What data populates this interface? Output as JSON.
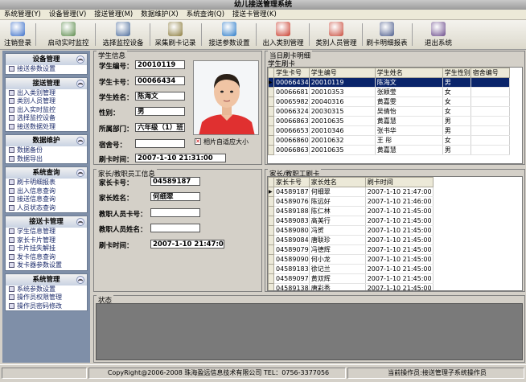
{
  "window": {
    "title": "幼儿接送管理系统"
  },
  "menu": [
    "系统管理(Y)",
    "设备管理(V)",
    "接送管理(M)",
    "数据维护(X)",
    "系统查询(Q)",
    "接送卡管理(K)"
  ],
  "toolbar": [
    {
      "label": "注销登录",
      "icon": "logout-icon",
      "color": "#3a6ec8"
    },
    {
      "label": "启动实时监控",
      "icon": "monitor-icon",
      "color": "#5a8a4a"
    },
    {
      "label": "选择监控设备",
      "icon": "device-icon",
      "color": "#4a6a9a"
    },
    {
      "label": "采集刷卡记录",
      "icon": "collect-icon",
      "color": "#8a7a3a"
    },
    {
      "label": "接送参数设置",
      "icon": "settings-icon",
      "color": "#2a7ac8"
    },
    {
      "label": "出入类别管理",
      "icon": "person-icon",
      "color": "#c83a2a"
    },
    {
      "label": "类别人员管理",
      "icon": "people-icon",
      "color": "#c84a3a"
    },
    {
      "label": "刷卡明细报表",
      "icon": "report-icon",
      "color": "#4a5a8a"
    },
    {
      "label": "退出系统",
      "icon": "exit-icon",
      "color": "#6a4a8a"
    }
  ],
  "sidebar": [
    {
      "title": "设备管理",
      "items": [
        "接送参数设置"
      ]
    },
    {
      "title": "接送管理",
      "items": [
        "出入类别管理",
        "类别人员管理",
        "出入实时监控",
        "选择监控设备",
        "接送数据处理"
      ]
    },
    {
      "title": "数据维护",
      "items": [
        "数据备份",
        "数据导出"
      ]
    },
    {
      "title": "系统查询",
      "items": [
        "刷卡明细报表",
        "出入信息查询",
        "接送信息查询",
        "人员状态查询"
      ]
    },
    {
      "title": "接送卡管理",
      "items": [
        "学生信息管理",
        "家长卡片管理",
        "卡片挂失解挂",
        "发卡信息查询",
        "发卡器参数设置"
      ]
    },
    {
      "title": "系统管理",
      "items": [
        "系统参数设置",
        "操作员权限管理",
        "操作员密码修改"
      ]
    }
  ],
  "student": {
    "section_title": "学生信息",
    "labels": {
      "id": "学生编号：",
      "card": "学生卡号：",
      "name": "学生姓名：",
      "gender": "性别：",
      "dept": "所属部门：",
      "dorm": "宿舍号：",
      "swipe_time": "刷卡时间："
    },
    "values": {
      "id": "20010119",
      "card": "00066434",
      "name": "陈海文",
      "gender": "男",
      "dept": "六年级（1）班",
      "dorm": "",
      "swipe_time": "2007-1-10 21:31:00"
    },
    "photo_checkbox": "相片自适应大小",
    "photo_checked": true
  },
  "parent": {
    "section_title": "家长/教职员工信息",
    "labels": {
      "card": "家长卡号：",
      "name": "家长姓名：",
      "staff_card": "教职人员卡号：",
      "staff_name": "教职人员姓名：",
      "swipe_time": "刷卡时间："
    },
    "values": {
      "card": "04589187",
      "name": "何细翠",
      "staff_card": "",
      "staff_name": "",
      "swipe_time": "2007-1-10 21:47:00"
    }
  },
  "today_swipes": {
    "section_title": "当日刷卡明细",
    "sub_title": "学生刷卡",
    "columns": [
      "学生卡号",
      "学生编号",
      "学生姓名",
      "学生性别",
      "宿舍编号"
    ],
    "rows": [
      [
        "00066434",
        "20010119",
        "陈海文",
        "男",
        ""
      ],
      [
        "00066681",
        "20010353",
        "张颖莹",
        "女",
        ""
      ],
      [
        "00065982",
        "20040316",
        "黄嘉雯",
        "女",
        ""
      ],
      [
        "00066324",
        "20030315",
        "吴倩怡",
        "女",
        ""
      ],
      [
        "00066863",
        "20010635",
        "黄嘉慧",
        "男",
        ""
      ],
      [
        "00066653",
        "20010346",
        "张书华",
        "男",
        ""
      ],
      [
        "00066860",
        "20010632",
        "王  彤",
        "女",
        ""
      ],
      [
        "00066863",
        "20010635",
        "黄嘉慧",
        "男",
        ""
      ]
    ]
  },
  "parent_swipes": {
    "section_title": "家长/教职工刷卡",
    "columns": [
      "家长卡号",
      "家长姓名",
      "刷卡时间"
    ],
    "rows": [
      [
        "04589187",
        "何细翠",
        "2007-1-10 21:47:00"
      ],
      [
        "04589076",
        "陈远好",
        "2007-1-10 21:46:00"
      ],
      [
        "04589188",
        "陈仁林",
        "2007-1-10 21:45:00"
      ],
      [
        "04589083",
        "高美行",
        "2007-1-10 21:45:00"
      ],
      [
        "04589080",
        "冯贺",
        "2007-1-10 21:45:00"
      ],
      [
        "04589084",
        "唐联珍",
        "2007-1-10 21:45:00"
      ],
      [
        "04589079",
        "冯德辉",
        "2007-1-10 21:45:00"
      ],
      [
        "04589090",
        "何小龙",
        "2007-1-10 21:45:00"
      ],
      [
        "04589183",
        "徐记兰",
        "2007-1-10 21:45:00"
      ],
      [
        "04589097",
        "黄双辉",
        "2007-1-10 21:45:00"
      ],
      [
        "04589138",
        "唐彩秀",
        "2007-1-10 21:45:00"
      ]
    ]
  },
  "status_panel": {
    "title": "状态"
  },
  "statusbar": {
    "copyright": "CopyRight@2006-2008 珠海盈远信息技术有限公司 TEL：0756-3377056",
    "operator": "当前操作员:接送管理子系统操作员"
  }
}
